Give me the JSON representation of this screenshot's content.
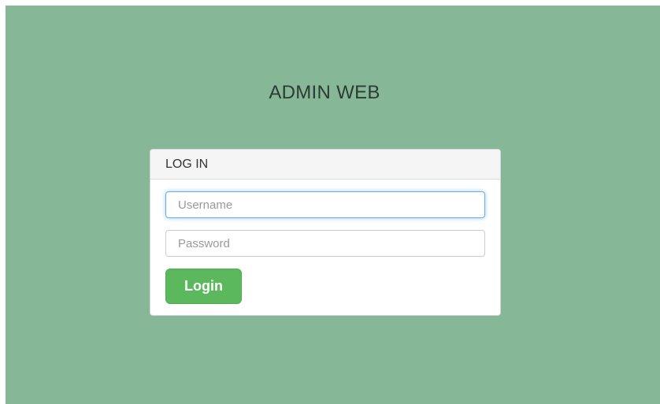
{
  "page": {
    "title": "ADMIN WEB"
  },
  "login_panel": {
    "heading": "LOG IN",
    "username": {
      "placeholder": "Username",
      "value": ""
    },
    "password": {
      "placeholder": "Password",
      "value": ""
    },
    "submit_label": "Login"
  },
  "colors": {
    "background": "#86b898",
    "panel_heading_bg": "#f5f5f5",
    "button_bg": "#5cb85c",
    "focus_border": "#66afe9"
  }
}
